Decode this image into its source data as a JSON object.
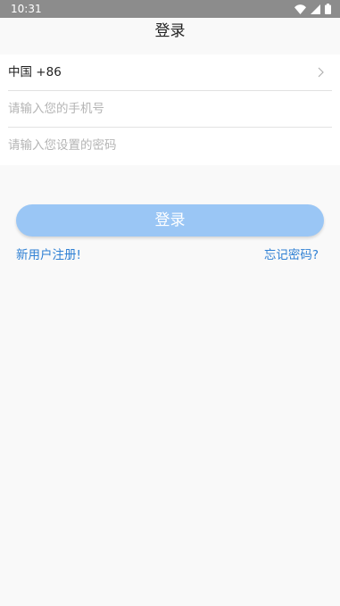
{
  "status_bar": {
    "time": "10:31",
    "icons": [
      "wifi-icon",
      "signal-icon",
      "battery-icon"
    ]
  },
  "header": {
    "title": "登录"
  },
  "form": {
    "country_code": "中国 +86",
    "phone_placeholder": "请输入您的手机号",
    "password_placeholder": "请输入您设置的密码"
  },
  "actions": {
    "login_label": "登录",
    "register_label": "新用户注册!",
    "forgot_label": "忘记密码?"
  },
  "colors": {
    "status_bar_bg": "#8c8c8c",
    "page_bg": "#f9f9f9",
    "button_bg": "#9ac6f5",
    "link": "#2f80d4"
  }
}
